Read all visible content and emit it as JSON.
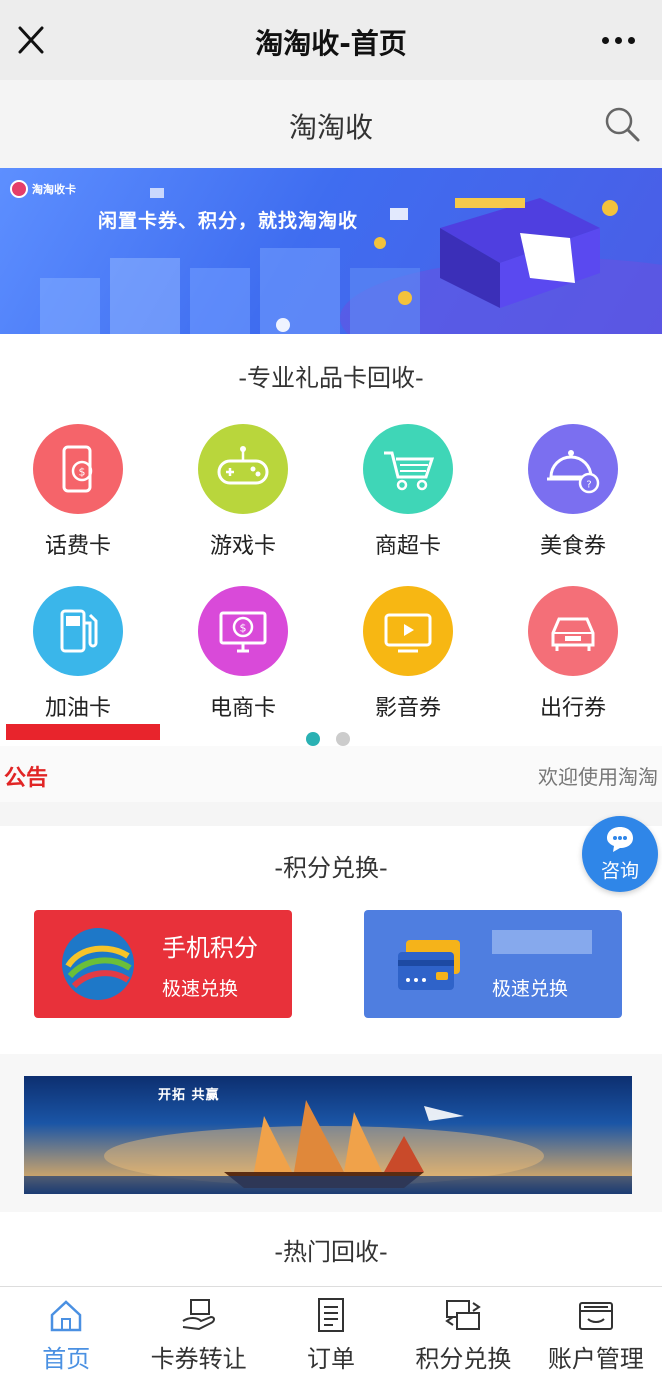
{
  "wechat_bar": {
    "title": "淘淘收-首页"
  },
  "app_header": {
    "title": "淘淘收"
  },
  "banner": {
    "logo_text": "淘淘收卡",
    "slogan": "闲置卡券、积分，就找淘淘收"
  },
  "gift_section": {
    "title": "-专业礼品卡回收-",
    "items": [
      {
        "label": "话费卡",
        "color": "#f5646a",
        "icon": "phone-card-icon"
      },
      {
        "label": "游戏卡",
        "color": "#b9d63c",
        "icon": "gamepad-icon"
      },
      {
        "label": "商超卡",
        "color": "#3fd6b7",
        "icon": "shopping-cart-icon"
      },
      {
        "label": "美食券",
        "color": "#7b6ff0",
        "icon": "food-cloche-icon"
      },
      {
        "label": "加油卡",
        "color": "#3ab6ea",
        "icon": "fuel-pump-icon"
      },
      {
        "label": "电商卡",
        "color": "#d94ad9",
        "icon": "ecommerce-monitor-icon"
      },
      {
        "label": "影音券",
        "color": "#f7b713",
        "icon": "video-play-icon"
      },
      {
        "label": "出行券",
        "color": "#f46f78",
        "icon": "car-icon"
      }
    ],
    "pager": {
      "active_color": "#2ab1b3",
      "inactive_color": "#cccccc"
    }
  },
  "notice": {
    "label": "公告",
    "text": "欢迎使用淘淘"
  },
  "consult": {
    "label": "咨询"
  },
  "points_section": {
    "title": "-积分兑换-",
    "cards": [
      {
        "title": "手机积分",
        "subtitle": "极速兑换",
        "color": "#e8313a"
      },
      {
        "title": "",
        "subtitle": "极速兑换",
        "color": "#4f7ee0"
      }
    ]
  },
  "promo_banner": {
    "caption": "开拓 共赢"
  },
  "hot_section": {
    "title": "-热门回收-"
  },
  "tabbar": {
    "items": [
      {
        "label": "首页",
        "icon": "home-icon",
        "active": true
      },
      {
        "label": "卡券转让",
        "icon": "card-transfer-icon",
        "active": false
      },
      {
        "label": "订单",
        "icon": "order-list-icon",
        "active": false
      },
      {
        "label": "积分兑换",
        "icon": "points-exchange-icon",
        "active": false
      },
      {
        "label": "账户管理",
        "icon": "account-wallet-icon",
        "active": false
      }
    ],
    "active_color": "#4a90e2"
  }
}
